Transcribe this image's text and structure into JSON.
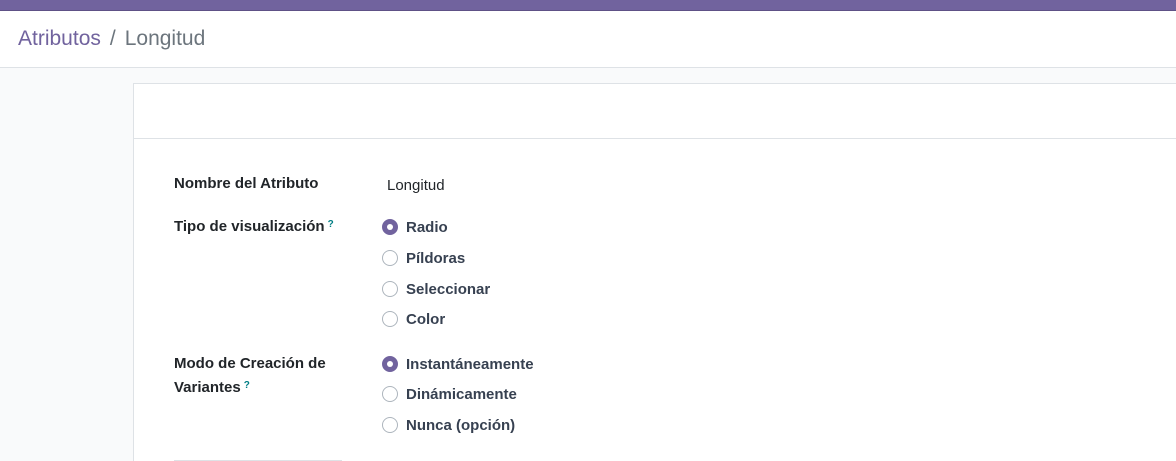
{
  "breadcrumb": {
    "parent": "Atributos",
    "separator": "/",
    "current": "Longitud"
  },
  "form": {
    "name": {
      "label": "Nombre del Atributo",
      "value": "Longitud"
    },
    "display_type": {
      "label": "Tipo de visualización",
      "help": "?",
      "options": [
        "Radio",
        "Píldoras",
        "Seleccionar",
        "Color"
      ],
      "selected": "Radio"
    },
    "create_variant": {
      "label_line1": "Modo de Creación de",
      "label_line2": "Variantes",
      "help": "?",
      "options": [
        "Instantáneamente",
        "Dinámicamente",
        "Nunca (opción)"
      ],
      "selected": "Instantáneamente"
    }
  },
  "colors": {
    "brand": "#71639e",
    "help": "#017e84"
  }
}
